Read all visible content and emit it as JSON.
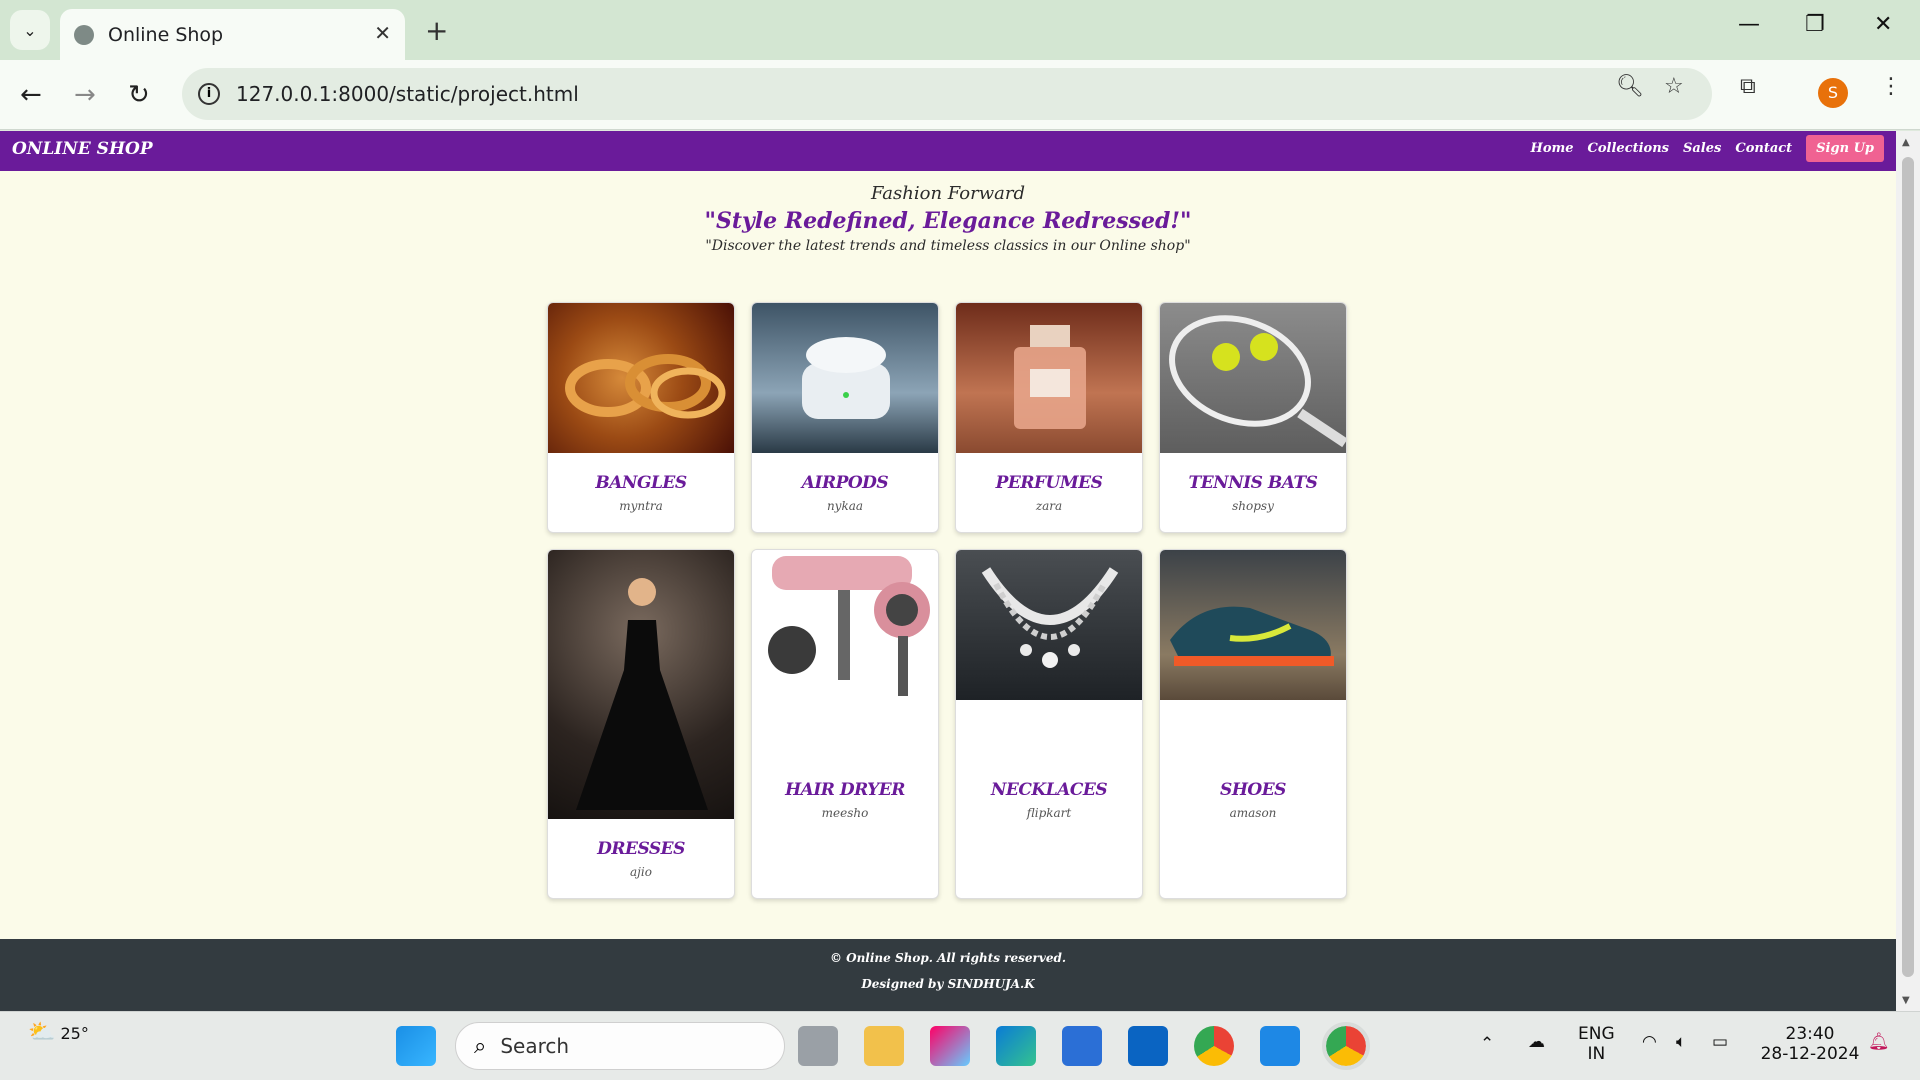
{
  "browser": {
    "tab_title": "Online Shop",
    "url": "127.0.0.1:8000/static/project.html",
    "profile_initial": "S"
  },
  "site": {
    "logo": "ONLINE SHOP",
    "nav": [
      "Home",
      "Collections",
      "Sales",
      "Contact"
    ],
    "signup": "Sign Up",
    "hero": {
      "line1": "Fashion Forward",
      "line2": "\"Style Redefined, Elegance Redressed!\"",
      "line3": "\"Discover the latest trends and timeless classics in our Online shop\""
    },
    "products": [
      {
        "name": "BANGLES",
        "store": "myntra"
      },
      {
        "name": "AIRPODS",
        "store": "nykaa"
      },
      {
        "name": "PERFUMES",
        "store": "zara"
      },
      {
        "name": "TENNIS BATS",
        "store": "shopsy"
      },
      {
        "name": "DRESSES",
        "store": "ajio"
      },
      {
        "name": "HAIR DRYER",
        "store": "meesho"
      },
      {
        "name": "NECKLACES",
        "store": "flipkart"
      },
      {
        "name": "SHOES",
        "store": "amason"
      }
    ],
    "footer": {
      "copyright": "© Online Shop. All rights reserved.",
      "designed": "Designed by SINDHUJA.K"
    }
  },
  "taskbar": {
    "weather_temp": "25°",
    "search_label": "Search",
    "lang_line1": "ENG",
    "lang_line2": "IN",
    "time": "23:40",
    "date": "28-12-2024"
  },
  "colors": {
    "brand_purple": "#6a1b9a",
    "signup_pink": "#f06292",
    "page_bg": "#fbfbe9",
    "footer_bg": "#333b40"
  }
}
